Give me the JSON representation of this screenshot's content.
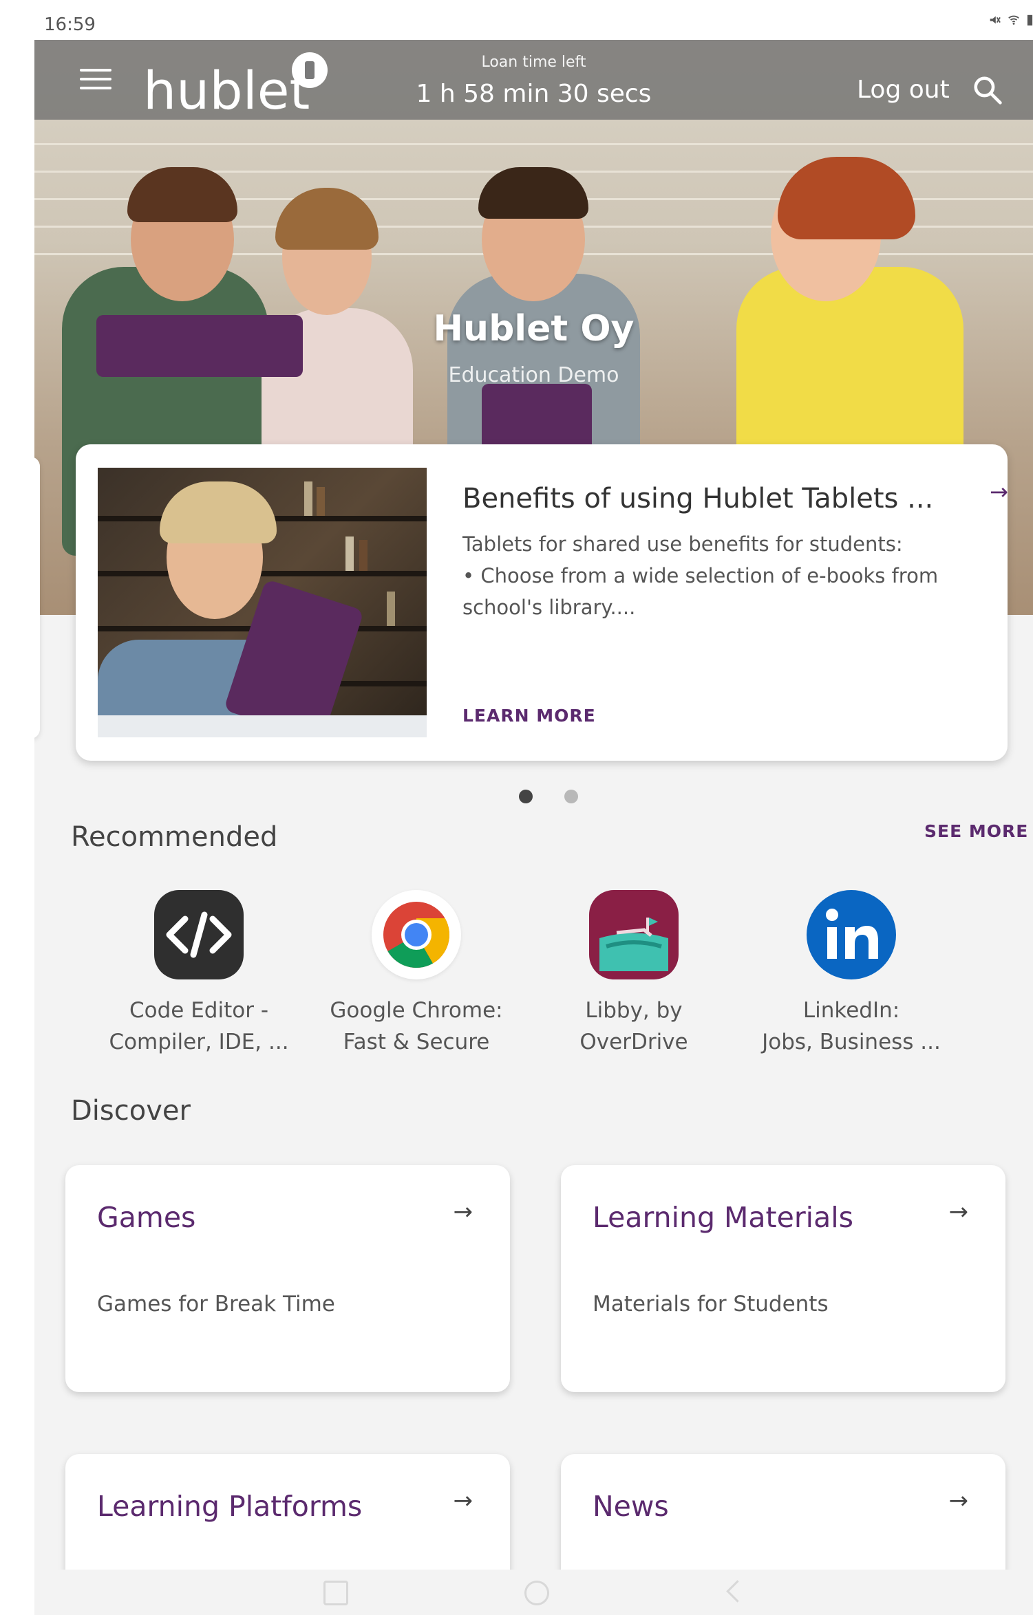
{
  "status_bar": {
    "time": "16:59"
  },
  "header": {
    "logo_text": "hublet",
    "loan_label": "Loan time left",
    "loan_time": "1 h 58 min 30 secs",
    "logout_label": "Log out"
  },
  "hero": {
    "title": "Hublet Oy",
    "subtitle": "Education Demo"
  },
  "featured": {
    "title": "Benefits of using Hublet Tablets ...",
    "desc_line1": "Tablets for shared use benefits for students:",
    "desc_line2": "• Choose from a wide selection of e-books from school's library....",
    "cta": "LEARN MORE",
    "pages": 2,
    "active_page": 1
  },
  "recommended": {
    "title": "Recommended",
    "see_more": "SEE MORE",
    "apps": [
      {
        "line1": "Code Editor -",
        "line2": "Compiler, IDE, ...",
        "icon": "code-editor-icon"
      },
      {
        "line1": "Google Chrome:",
        "line2": "Fast & Secure",
        "icon": "chrome-icon"
      },
      {
        "line1": "Libby, by",
        "line2": "OverDrive",
        "icon": "libby-icon"
      },
      {
        "line1": "LinkedIn:",
        "line2": "Jobs, Business ...",
        "icon": "linkedin-icon"
      }
    ]
  },
  "discover": {
    "title": "Discover",
    "cards": [
      {
        "title": "Games",
        "subtitle": "Games for Break Time"
      },
      {
        "title": "Learning Materials",
        "subtitle": "Materials for Students"
      },
      {
        "title": "Learning Platforms",
        "subtitle": ""
      },
      {
        "title": "News",
        "subtitle": ""
      }
    ]
  },
  "colors": {
    "accent": "#5b2a6e",
    "background": "#f3f3f3",
    "topbar": "#6e6e6e"
  }
}
